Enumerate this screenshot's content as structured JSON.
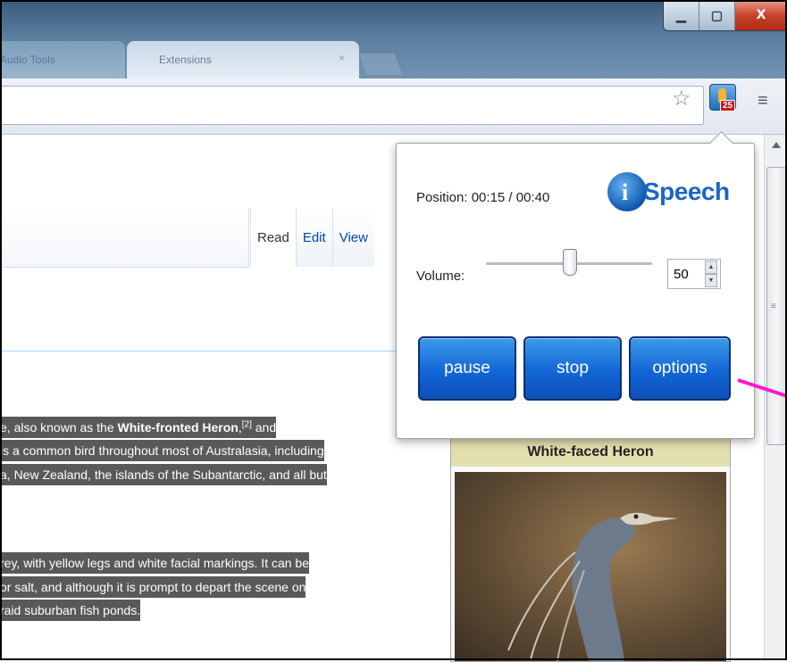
{
  "window": {
    "tabs": [
      {
        "label": "Audio Tools"
      },
      {
        "label": "Extensions"
      }
    ],
    "controls": {
      "minimize": "▁",
      "maximize": "▢",
      "close": "X"
    }
  },
  "toolbar": {
    "bookmark_star": "☆",
    "extension_badge": "25",
    "menu_glyph": "≡"
  },
  "page": {
    "nav_tabs": [
      "Read",
      "Edit",
      "View"
    ],
    "paragraph1": [
      {
        "text": "e, also known as the ",
        "bold": false
      },
      {
        "text": "White-fronted Heron",
        "bold": true
      },
      {
        "text": ",",
        "bold": false
      },
      {
        "text": "[2]",
        "sup": true
      },
      {
        "text": " and ",
        "bold": false
      },
      {
        "br": true
      },
      {
        "text": " is a common bird throughout most of Australasia, including",
        "bold": false
      },
      {
        "br": true
      },
      {
        "text": "a, New Zealand, the islands of the Subantarctic, and all but",
        "bold": false
      }
    ],
    "paragraph2": [
      {
        "text": "rey, with yellow legs and white facial markings. It can be",
        "bold": false
      },
      {
        "br": true
      },
      {
        "text": " or salt, and although it is prompt to depart the scene on",
        "bold": false
      },
      {
        "br": true
      },
      {
        "text": "raid suburban fish ponds.",
        "bold": false
      }
    ],
    "infobox_title": "White-faced Heron"
  },
  "popup": {
    "position_label": "Position:",
    "position_value": "00:15 / 00:40",
    "logo_i": "i",
    "logo_text": "Speech",
    "volume_label": "Volume:",
    "volume_value": "50",
    "volume_level_percent": 50,
    "buttons": {
      "pause": "pause",
      "stop": "stop",
      "options": "options"
    }
  },
  "colors": {
    "accent_button": "#1266d6",
    "highlight_bg": "#595959",
    "annotation_arrow": "#ff18d0",
    "infobox_header": "#e3e0b0"
  }
}
